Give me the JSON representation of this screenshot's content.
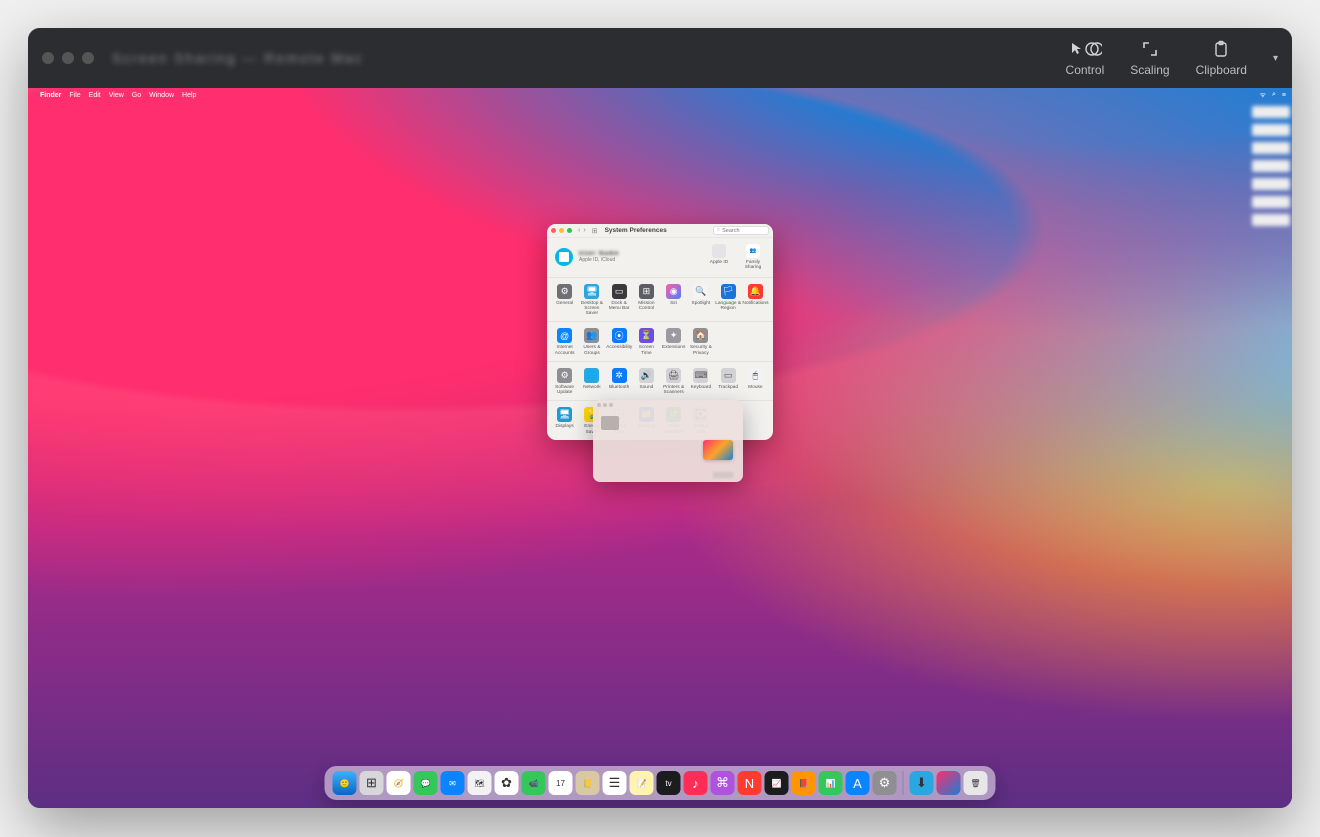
{
  "outer": {
    "title": "Screen Sharing — Remote Mac",
    "tools": {
      "control": "Control",
      "scaling": "Scaling",
      "clipboard": "Clipboard"
    }
  },
  "menubar": {
    "app": "Finder",
    "items": [
      "File",
      "Edit",
      "View",
      "Go",
      "Window",
      "Help"
    ]
  },
  "sysprefs": {
    "title": "System Preferences",
    "search_placeholder": "Search",
    "user_name": "User Name",
    "user_sub": "Apple ID, iCloud",
    "header_right": [
      {
        "label": "Apple ID",
        "color": "#e4e4e7",
        "glyph": ""
      },
      {
        "label": "Family Sharing",
        "color": "#ffffff",
        "glyph": "👥"
      }
    ],
    "rows": [
      [
        {
          "label": "General",
          "bg": "#6f6f76",
          "glyph": "⚙"
        },
        {
          "label": "Desktop & Screen Saver",
          "bg": "#2aa7e1",
          "glyph": "🖥"
        },
        {
          "label": "Dock & Menu Bar",
          "bg": "#3a3a3c",
          "glyph": "▭"
        },
        {
          "label": "Mission Control",
          "bg": "#5d5d66",
          "glyph": "⊞"
        },
        {
          "label": "Siri",
          "bg": "linear-gradient(135deg,#ff5fa2,#4f7cff)",
          "glyph": "◉"
        },
        {
          "label": "Spotlight",
          "bg": "#f4f4f6",
          "glyph": "🔍"
        },
        {
          "label": "Language & Region",
          "bg": "#1e73d6",
          "glyph": "🏳"
        },
        {
          "label": "Notifications",
          "bg": "#ff3b30",
          "glyph": "🔔"
        }
      ],
      [
        {
          "label": "Internet Accounts",
          "bg": "#0a84ff",
          "glyph": "@"
        },
        {
          "label": "Users & Groups",
          "bg": "#8e8e93",
          "glyph": "👥"
        },
        {
          "label": "Accessibility",
          "bg": "#0a7aff",
          "glyph": "⦿"
        },
        {
          "label": "Screen Time",
          "bg": "#6b4ee6",
          "glyph": "⏳"
        },
        {
          "label": "Extensions",
          "bg": "#9a9aa0",
          "glyph": "✦"
        },
        {
          "label": "Security & Privacy",
          "bg": "#8e8e93",
          "glyph": "🏠"
        }
      ],
      [
        {
          "label": "Software Update",
          "bg": "#8e8e93",
          "glyph": "⚙"
        },
        {
          "label": "Network",
          "bg": "#2aa7e1",
          "glyph": "🌐"
        },
        {
          "label": "Bluetooth",
          "bg": "#0a7aff",
          "glyph": "✲"
        },
        {
          "label": "Sound",
          "bg": "#d1d1d6",
          "glyph": "🔊"
        },
        {
          "label": "Printers & Scanners",
          "bg": "#d1d1d6",
          "glyph": "🖨"
        },
        {
          "label": "Keyboard",
          "bg": "#d1d1d6",
          "glyph": "⌨"
        },
        {
          "label": "Trackpad",
          "bg": "#d1d1d6",
          "glyph": "▭"
        },
        {
          "label": "Mouse",
          "bg": "#f2f2f4",
          "glyph": "🖱"
        }
      ],
      [
        {
          "label": "Displays",
          "bg": "#1e9ad6",
          "glyph": "🖥"
        },
        {
          "label": "Energy Saver",
          "bg": "#ffd60a",
          "glyph": "💡"
        },
        {
          "label": "Date & Time",
          "bg": "#f2f2f4",
          "glyph": "🕒"
        },
        {
          "label": "Sharing",
          "bg": "#0a7aff",
          "glyph": "📁"
        },
        {
          "label": "Time Machine",
          "bg": "#34c759",
          "glyph": "↺"
        },
        {
          "label": "Startup Disk",
          "bg": "#d1d1d6",
          "glyph": "💽"
        }
      ]
    ]
  },
  "dock": [
    {
      "name": "finder",
      "bg": "linear-gradient(180deg,#3bb2ff,#0a66c2)",
      "glyph": "🙂"
    },
    {
      "name": "launchpad",
      "bg": "#d7d7db",
      "glyph": "⊞"
    },
    {
      "name": "safari",
      "bg": "#ffffff",
      "glyph": "🧭"
    },
    {
      "name": "messages",
      "bg": "#34c759",
      "glyph": "💬"
    },
    {
      "name": "mail",
      "bg": "#0a84ff",
      "glyph": "✉︎"
    },
    {
      "name": "maps",
      "bg": "#f2f2f4",
      "glyph": "🗺"
    },
    {
      "name": "photos",
      "bg": "#ffffff",
      "glyph": "✿"
    },
    {
      "name": "facetime",
      "bg": "#34c759",
      "glyph": "📹"
    },
    {
      "name": "calendar",
      "bg": "#ffffff",
      "glyph": "17"
    },
    {
      "name": "contacts",
      "bg": "#d9c9a3",
      "glyph": "📒"
    },
    {
      "name": "reminders",
      "bg": "#ffffff",
      "glyph": "☰"
    },
    {
      "name": "notes",
      "bg": "#fff3b0",
      "glyph": "📝"
    },
    {
      "name": "tv",
      "bg": "#1c1c1e",
      "glyph": "tv"
    },
    {
      "name": "music",
      "bg": "#ff2d55",
      "glyph": "♪"
    },
    {
      "name": "podcasts",
      "bg": "#af52de",
      "glyph": "⌘"
    },
    {
      "name": "news",
      "bg": "#ff3b30",
      "glyph": "N"
    },
    {
      "name": "stocks",
      "bg": "#1c1c1e",
      "glyph": "📈"
    },
    {
      "name": "books",
      "bg": "#ff9500",
      "glyph": "📕"
    },
    {
      "name": "numbers",
      "bg": "#34c759",
      "glyph": "📊"
    },
    {
      "name": "appstore",
      "bg": "#0a84ff",
      "glyph": "A"
    },
    {
      "name": "settings",
      "bg": "#8e8e93",
      "glyph": "⚙"
    }
  ],
  "dock_right": [
    {
      "name": "downloads",
      "bg": "#2aa7e1",
      "glyph": "⬇"
    },
    {
      "name": "screenshot",
      "bg": "linear-gradient(135deg,#ff2e6e,#1a7fd6)",
      "glyph": ""
    },
    {
      "name": "trash",
      "bg": "#e7e7ea",
      "glyph": "🗑"
    }
  ]
}
